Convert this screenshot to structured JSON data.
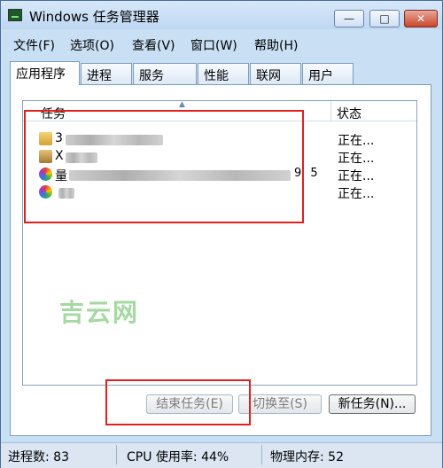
{
  "window": {
    "title": "Windows 任务管理器",
    "minimize_glyph": "—",
    "maximize_glyph": "□",
    "close_glyph": "✕"
  },
  "menu": [
    "文件(F)",
    "选项(O)",
    "查看(V)",
    "窗口(W)",
    "帮助(H)"
  ],
  "tabs": [
    "应用程序",
    "进程",
    "服务",
    "性能",
    "联网",
    "用户"
  ],
  "active_tab": "应用程序",
  "list": {
    "columns": {
      "task": "任务",
      "status": "状态"
    },
    "rows": [
      {
        "icon": "folder-icon",
        "task_visible": "3",
        "status": "正在..."
      },
      {
        "icon": "package-icon",
        "task_visible": "X",
        "status": "正在..."
      },
      {
        "icon": "color-wheel-icon",
        "task_visible": "量",
        "task_tail": "9 5",
        "status": "正在..."
      },
      {
        "icon": "color-wheel-icon",
        "task_visible": "",
        "status": "正在..."
      }
    ]
  },
  "buttons": {
    "end_task": "结束任务(E)",
    "switch_to": "切换至(S)",
    "new_task": "新任务(N)..."
  },
  "status_bar": {
    "processes": "进程数: 83",
    "cpu": "CPU 使用率: 44%",
    "memory": "物理内存: 52"
  },
  "watermark": "吉云网",
  "colors": {
    "highlight_box": "#e0201c",
    "close_button": "#c9462a"
  }
}
